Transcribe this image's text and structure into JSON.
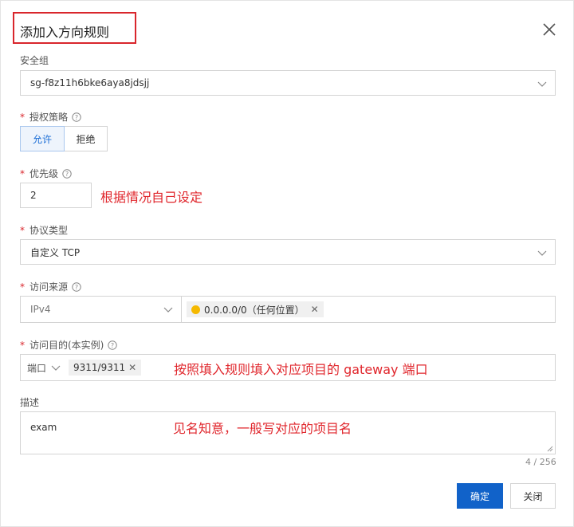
{
  "dialog": {
    "title": "添加入方向规则",
    "close_icon": "close-icon"
  },
  "security_group": {
    "label": "安全组",
    "value": "sg-f8z11h6bke6aya8jdsjj"
  },
  "auth_policy": {
    "label": "授权策略",
    "options": [
      "允许",
      "拒绝"
    ],
    "selected": "允许"
  },
  "priority": {
    "label": "优先级",
    "value": "2",
    "note": "根据情况自己设定"
  },
  "protocol": {
    "label": "协议类型",
    "value": "自定义 TCP"
  },
  "source": {
    "label": "访问来源",
    "ip_type": "IPv4",
    "tag": "0.0.0.0/0（任何位置）"
  },
  "destination": {
    "label": "访问目的(本实例)",
    "type": "端口",
    "tag": "9311/9311",
    "note": "按照填入规则填入对应项目的 gateway 端口"
  },
  "description": {
    "label": "描述",
    "value": "exam",
    "counter": "4 / 256",
    "note": "见名知意，一般写对应的项目名"
  },
  "footer": {
    "confirm_label": "确定",
    "close_label": "关闭"
  },
  "colors": {
    "primary": "#1162c9",
    "required": "#d9262c",
    "annotation": "#e0262c",
    "warning": "#f5b900"
  }
}
